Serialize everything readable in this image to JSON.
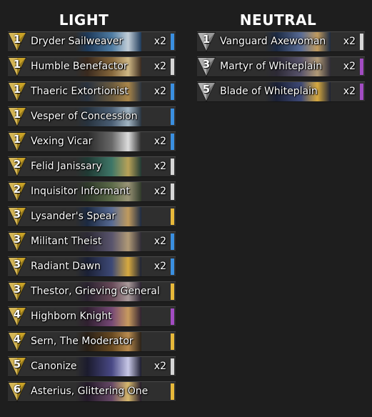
{
  "light": {
    "title": "LIGHT",
    "cards": [
      {
        "cost": "1",
        "name": "Dryder Sailweaver",
        "count": "x2",
        "rarity": "rare"
      },
      {
        "cost": "1",
        "name": "Humble Benefactor",
        "count": "x2",
        "rarity": "common"
      },
      {
        "cost": "1",
        "name": "Thaeric Extortionist",
        "count": "x2",
        "rarity": "rare"
      },
      {
        "cost": "1",
        "name": "Vesper of Concession",
        "count": "",
        "rarity": "rare"
      },
      {
        "cost": "1",
        "name": "Vexing Vicar",
        "count": "x2",
        "rarity": "rare"
      },
      {
        "cost": "2",
        "name": "Felid Janissary",
        "count": "x2",
        "rarity": "common"
      },
      {
        "cost": "2",
        "name": "Inquisitor Informant",
        "count": "x2",
        "rarity": "common"
      },
      {
        "cost": "3",
        "name": "Lysander's Spear",
        "count": "",
        "rarity": "legendary"
      },
      {
        "cost": "3",
        "name": "Militant Theist",
        "count": "x2",
        "rarity": "rare"
      },
      {
        "cost": "3",
        "name": "Radiant Dawn",
        "count": "x2",
        "rarity": "rare"
      },
      {
        "cost": "3",
        "name": "Thestor, Grieving General",
        "count": "",
        "rarity": "legendary"
      },
      {
        "cost": "4",
        "name": "Highborn Knight",
        "count": "",
        "rarity": "epic"
      },
      {
        "cost": "4",
        "name": "Sern, The Moderator",
        "count": "",
        "rarity": "legendary"
      },
      {
        "cost": "5",
        "name": "Canonize",
        "count": "x2",
        "rarity": "common"
      },
      {
        "cost": "6",
        "name": "Asterius, Glittering One",
        "count": "",
        "rarity": "legendary"
      }
    ]
  },
  "neutral": {
    "title": "NEUTRAL",
    "cards": [
      {
        "cost": "1",
        "name": "Vanguard Axewoman",
        "count": "x2",
        "rarity": "common"
      },
      {
        "cost": "3",
        "name": "Martyr of Whiteplain",
        "count": "x2",
        "rarity": "epic"
      },
      {
        "cost": "5",
        "name": "Blade of Whiteplain",
        "count": "x2",
        "rarity": "epic"
      }
    ]
  },
  "colors": {
    "light_gem": "#c9a227",
    "neutral_gem": "#9a9a9a",
    "common": "#d6d6d6",
    "rare": "#3a8fe0",
    "epic": "#a24cc2",
    "legendary": "#e7b83a"
  }
}
